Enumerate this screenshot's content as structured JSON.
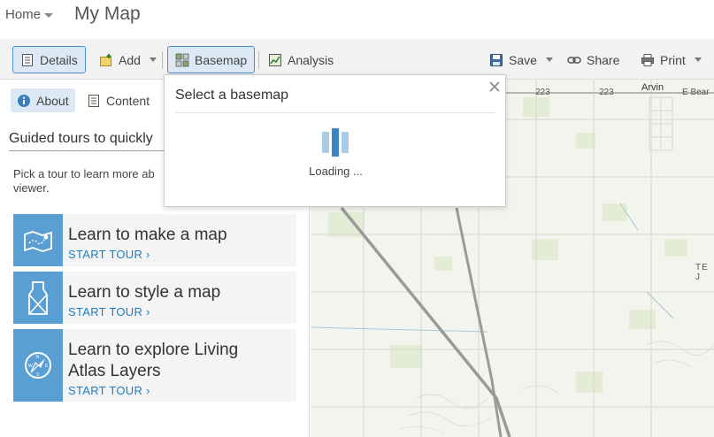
{
  "header": {
    "home_label": "Home",
    "map_title": "My Map"
  },
  "toolbar": {
    "details": "Details",
    "add": "Add",
    "basemap": "Basemap",
    "analysis": "Analysis",
    "save": "Save",
    "share": "Share",
    "print": "Print"
  },
  "panel": {
    "tabs": {
      "about": "About",
      "content": "Content"
    },
    "guided_title": "Guided tours to quickly",
    "pick_text": "Pick a tour to learn more ab",
    "pick_text_2": "viewer.",
    "tours": [
      {
        "title": "Learn to make a map",
        "link": "START TOUR ›"
      },
      {
        "title": "Learn to style a map",
        "link": "START TOUR ›"
      },
      {
        "title_1": "Learn to explore Living",
        "title_2": "Atlas Layers",
        "link": "START TOUR ›"
      }
    ]
  },
  "popup": {
    "title": "Select a basemap",
    "loading": "Loading ..."
  },
  "map_labels": {
    "road_223_a": "223",
    "road_223_b": "223",
    "arvin": "Arvin",
    "e_bear": "E Bear",
    "tej": "TE J"
  },
  "colors": {
    "accent": "#5a9fd4",
    "link": "#1c7dc1",
    "active_bg": "#dce9f5",
    "active_border": "#4d90c9"
  }
}
